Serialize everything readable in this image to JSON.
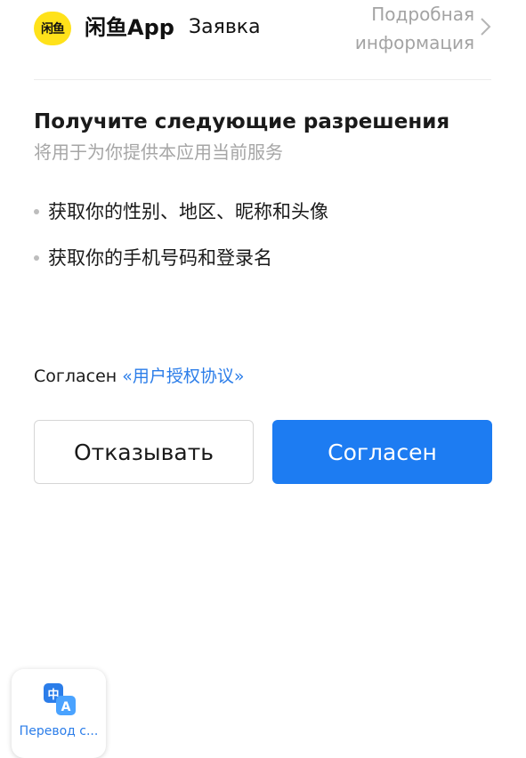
{
  "header": {
    "app_logo_text": "闲鱼",
    "app_name": "闲鱼App",
    "request_label": "Заявка",
    "details_line1": "Подробная",
    "details_line2": "информация"
  },
  "permissions": {
    "title": "Получите следующие разрешения",
    "subtitle": "将用于为你提供本应用当前服务",
    "items": [
      "获取你的性别、地区、昵称和头像",
      "获取你的手机号码和登录名"
    ]
  },
  "agreement": {
    "prefix": "Согласен ",
    "link_text": "«用户授权协议»"
  },
  "buttons": {
    "decline_label": "Отказывать",
    "accept_label": "Согласен"
  },
  "translate_widget": {
    "label": "Перевод с..."
  },
  "colors": {
    "accent": "#1d7cf2",
    "link": "#2b7de9",
    "logo_bg": "#ffe21a",
    "muted_text": "#a6a6a6"
  },
  "icons": {
    "logo": "xianyu-logo",
    "details": "chevron-right-icon",
    "translate": "translate-icon"
  }
}
